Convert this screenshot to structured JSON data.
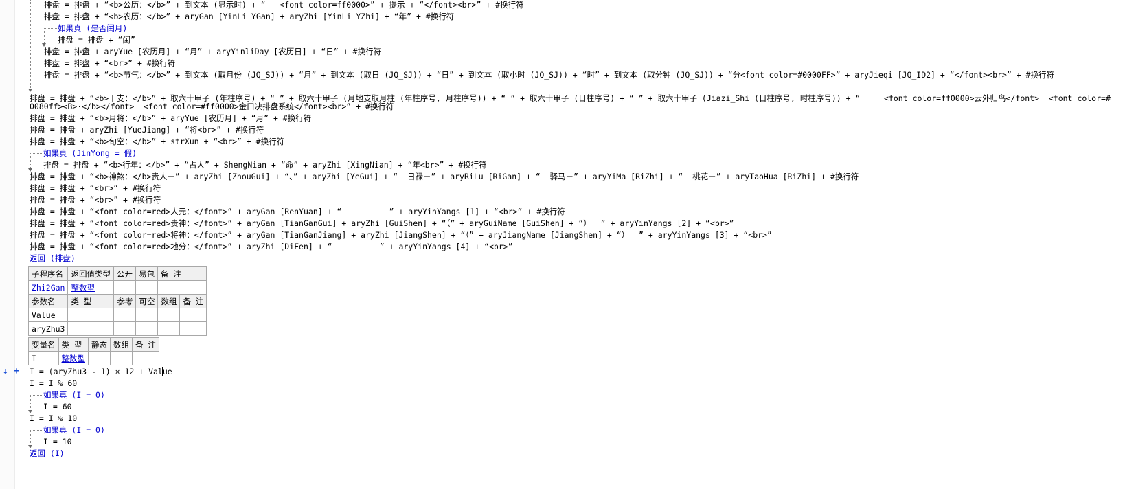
{
  "code_lines_top": [
    "排盘 = 排盘 + “<b>公历：</b>” + 到文本 (显示时) + “   <font color=ff0000>” + 提示 + “</font><br>” + #换行符",
    "排盘 = 排盘 + “<b>农历：</b>” + aryGan [YinLi_YGan] + aryZhi [YinLi_YZhi] + “年” + #换行符",
    "如果真 (是否闰月)",
    "排盘 = 排盘 + “闰”",
    "排盘 = 排盘 + aryYue [农历月] + “月” + aryYinliDay [农历日] + “日” + #换行符",
    "排盘 = 排盘 + “<br>” + #换行符",
    "排盘 = 排盘 + “<b>节气：</b>” + 到文本 (取月份 (JQ_SJ)) + “月” + 到文本 (取日 (JQ_SJ)) + “日” + 到文本 (取小时 (JQ_SJ)) + “时” + 到文本 (取分钟 (JQ_SJ)) + “分<font color=#0000FF>” + aryJieqi [JQ_ID2] + “</font><br>” + #换行符"
  ],
  "code_lines_main": [
    "排盘 = 排盘 + “<b>干支：</b>” + 取六十甲子 (年柱序号) + “ ” + 取六十甲子 (月地支取月柱 (年柱序号, 月柱序号)) + “ ” + 取六十甲子 (日柱序号) + “ ” + 取六十甲子 (Jiazi_Shi (日柱序号, 时柱序号)) + “     <font color=ff0000>云外归鸟</font>  <font color=#",
    "0080ff><B>·</b></font>  <font color=#ff0000>金口决排盘系统</font><br>” + #换行符",
    "排盘 = 排盘 + “<b>月将：</b>” + aryYue [农历月] + “月” + #换行符",
    "排盘 = 排盘 + aryZhi [YueJiang] + “将<br>” + #换行符",
    "排盘 = 排盘 + “<b>旬空：</b>” + strXun + “<br>” + #换行符",
    "如果真 (JinYong = 假)",
    "排盘 = 排盘 + “<b>行年：</b>” + “占人” + ShengNian + “命” + aryZhi [XingNian] + “年<br>” + #换行符",
    "排盘 = 排盘 + “<b>神煞：</b>贵人－” + aryZhi [ZhouGui] + “、” + aryZhi [YeGui] + “  日禄－” + aryRiLu [RiGan] + “  驿马－” + aryYiMa [RiZhi] + “  桃花－” + aryTaoHua [RiZhi] + #换行符",
    "排盘 = 排盘 + “<br>” + #换行符",
    "排盘 = 排盘 + “<br>” + #换行符",
    "排盘 = 排盘 + “<font color=red>人元：</font>” + aryGan [RenYuan] + “          ” + aryYinYangs [1] + “<br>” + #换行符",
    "排盘 = 排盘 + “<font color=red>贵神：</font>” + aryGan [TianGanGui] + aryZhi [GuiShen] + “（” + aryGuiName [GuiShen] + “）  ” + aryYinYangs [2] + “<br>”",
    "排盘 = 排盘 + “<font color=red>将神：</font>” + aryGan [TianGanJiang] + aryZhi [JiangShen] + “（” + aryJiangName [JiangShen] + “）  ” + aryYinYangs [3] + “<br>”",
    "排盘 = 排盘 + “<font color=red>地分：</font>” + aryZhi [DiFen] + “          ” + aryYinYangs [4] + “<br>”",
    "返回 (排盘)"
  ],
  "sub_table": {
    "headers": [
      "子程序名",
      "返回值类型",
      "公开",
      "易包",
      "备 注"
    ],
    "row": [
      "Zhi2Gan",
      "整数型",
      "",
      "",
      ""
    ],
    "param_headers": [
      "参数名",
      "类 型",
      "参考",
      "可空",
      "数组",
      "备 注"
    ],
    "params": [
      [
        "Value",
        "",
        "",
        "",
        "",
        ""
      ],
      [
        "aryZhu3",
        "",
        "",
        "",
        "",
        ""
      ]
    ]
  },
  "var_table": {
    "headers": [
      "变量名",
      "类 型",
      "静态",
      "数组",
      "备 注"
    ],
    "row": [
      "I",
      "整数型",
      "",
      "",
      ""
    ]
  },
  "code_lines_bottom": [
    "I = (aryZhu3 - 1) × 12 + Value",
    "I = I % 60",
    "如果真 (I = 0)",
    "I = 60",
    "I = I % 10",
    "如果真 (I = 0)",
    "I = 10",
    "返回 (I)"
  ],
  "gutter_icons": {
    "arrow": "↓",
    "plus": "+"
  }
}
